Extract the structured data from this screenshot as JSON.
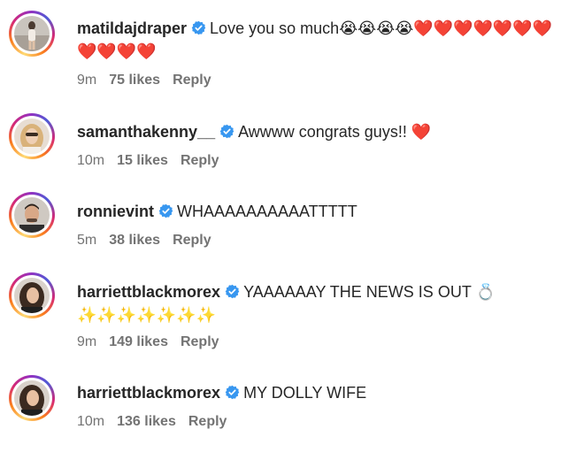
{
  "comments": [
    {
      "username": "matildajdraper",
      "verified": true,
      "text": "Love you so much😭😭😭😭❤️❤️❤️❤️❤️❤️❤️❤️❤️❤️❤️",
      "time": "9m",
      "likes": "75 likes",
      "reply": "Reply",
      "avatar": "woman-standing-avatar"
    },
    {
      "username": "samanthakenny__",
      "verified": true,
      "text": "Awwww congrats guys!! ❤️",
      "time": "10m",
      "likes": "15 likes",
      "reply": "Reply",
      "avatar": "blonde-woman-avatar"
    },
    {
      "username": "ronnievint",
      "verified": true,
      "text": "WHAAAAAAAAAATTTTT",
      "time": "5m",
      "likes": "38 likes",
      "reply": "Reply",
      "avatar": "man-avatar"
    },
    {
      "username": "harriettblackmorex",
      "verified": true,
      "text": "YAAAAAAY THE NEWS IS OUT 💍✨✨✨✨✨✨✨",
      "time": "9m",
      "likes": "149 likes",
      "reply": "Reply",
      "avatar": "brunette-woman-avatar"
    },
    {
      "username": "harriettblackmorex",
      "verified": true,
      "text": "MY DOLLY WIFE",
      "time": "10m",
      "likes": "136 likes",
      "reply": "Reply",
      "avatar": "brunette-woman-avatar"
    }
  ],
  "colors": {
    "verified_badge": "#3897f0",
    "meta_text": "#737373",
    "username_text": "#262626"
  }
}
